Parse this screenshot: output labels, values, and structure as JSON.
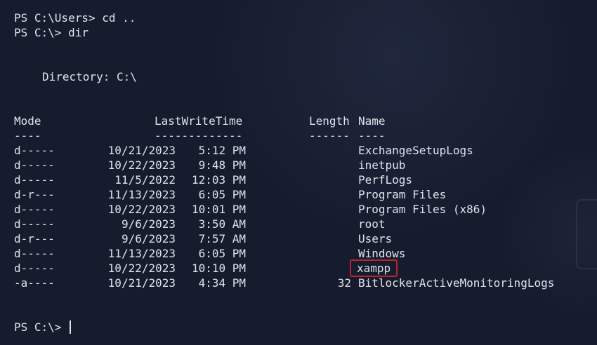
{
  "session": {
    "history": [
      "PS C:\\Users> cd ..",
      "PS C:\\> dir"
    ],
    "directory_header": "Directory: C:\\",
    "prompt": "PS C:\\> "
  },
  "listing": {
    "headers": {
      "mode": "Mode",
      "last_write_time": "LastWriteTime",
      "length": "Length",
      "name": "Name"
    },
    "separators": {
      "mode": "----",
      "last_write_time": "-------------",
      "length": "------",
      "name": "----"
    },
    "rows": [
      {
        "mode": "d-----",
        "date": "10/21/2023",
        "time": "5:12 PM",
        "length": "",
        "name": "ExchangeSetupLogs"
      },
      {
        "mode": "d-----",
        "date": "10/22/2023",
        "time": "9:48 PM",
        "length": "",
        "name": "inetpub"
      },
      {
        "mode": "d-----",
        "date": "11/5/2022",
        "time": "12:03 PM",
        "length": "",
        "name": "PerfLogs"
      },
      {
        "mode": "d-r---",
        "date": "11/13/2023",
        "time": "6:05 PM",
        "length": "",
        "name": "Program Files"
      },
      {
        "mode": "d-----",
        "date": "10/22/2023",
        "time": "10:01 PM",
        "length": "",
        "name": "Program Files (x86)"
      },
      {
        "mode": "d-----",
        "date": "9/6/2023",
        "time": "3:50 AM",
        "length": "",
        "name": "root"
      },
      {
        "mode": "d-r---",
        "date": "9/6/2023",
        "time": "7:57 AM",
        "length": "",
        "name": "Users"
      },
      {
        "mode": "d-----",
        "date": "11/13/2023",
        "time": "6:05 PM",
        "length": "",
        "name": "Windows"
      },
      {
        "mode": "d-----",
        "date": "10/22/2023",
        "time": "10:10 PM",
        "length": "",
        "name": "xampp"
      },
      {
        "mode": "-a----",
        "date": "10/21/2023",
        "time": "4:34 PM",
        "length": "32",
        "name": "BitlockerActiveMonitoringLogs"
      }
    ]
  },
  "colors": {
    "background": "#161c2e",
    "text": "#dfe3ea",
    "highlight_box": "#b3262f"
  }
}
